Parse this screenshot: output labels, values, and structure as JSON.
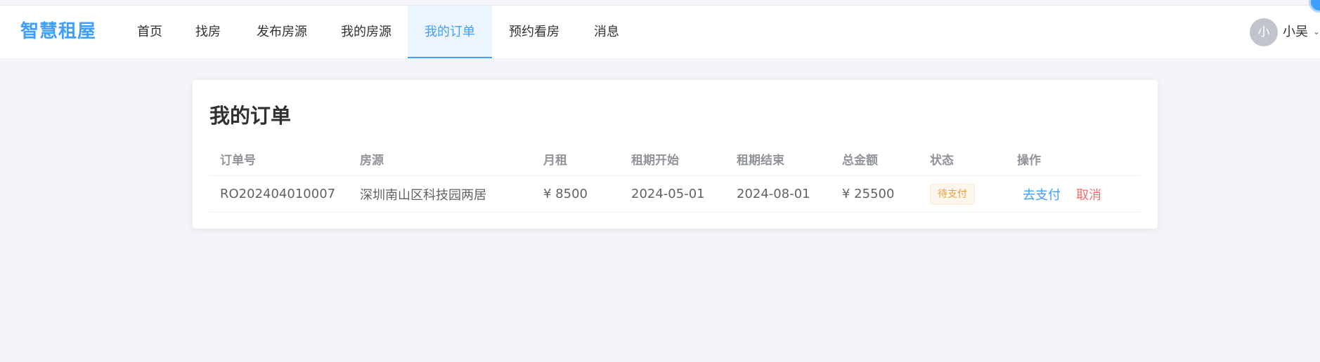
{
  "brand": "智慧租屋",
  "nav": {
    "items": [
      {
        "label": "首页"
      },
      {
        "label": "找房"
      },
      {
        "label": "发布房源"
      },
      {
        "label": "我的房源"
      },
      {
        "label": "我的订单"
      },
      {
        "label": "预约看房"
      },
      {
        "label": "消息"
      }
    ],
    "active": "我的订单"
  },
  "user": {
    "avatar_text": "小",
    "name": "小吴",
    "caret": "⌄"
  },
  "page": {
    "title": "我的订单"
  },
  "table": {
    "columns": [
      "订单号",
      "房源",
      "月租",
      "租期开始",
      "租期结束",
      "总金额",
      "状态",
      "操作"
    ],
    "rows": [
      {
        "order_no": "RO202404010007",
        "property": "深圳南山区科技园两居",
        "rent": "¥ 8500",
        "start": "2024-05-01",
        "end": "2024-08-01",
        "total": "¥ 25500",
        "status": "待支付",
        "actions": {
          "pay": "去支付",
          "cancel": "取消"
        }
      }
    ]
  },
  "colors": {
    "accent": "#409eff",
    "status_pending": "#e6a23c",
    "danger": "#f56c6c",
    "page_bg": "#f4f5f8"
  }
}
